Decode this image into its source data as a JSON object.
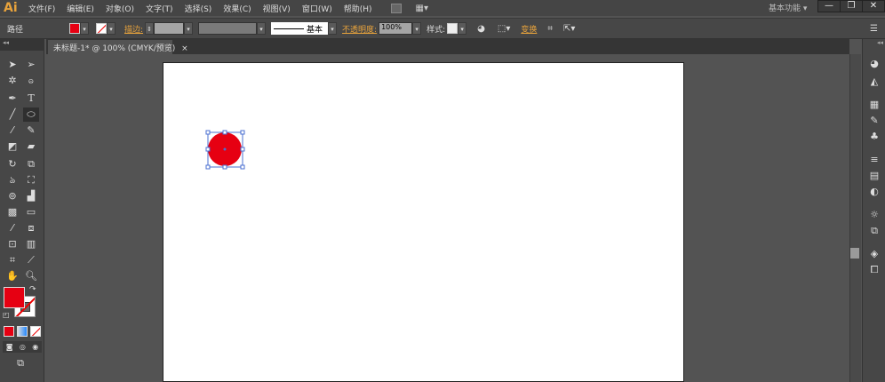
{
  "app": {
    "logo": "Ai",
    "workspace": "基本功能 ▾",
    "win": {
      "min": "—",
      "restore": "❐",
      "close": "✕"
    }
  },
  "menu": [
    "文件(F)",
    "编辑(E)",
    "对象(O)",
    "文字(T)",
    "选择(S)",
    "效果(C)",
    "视图(V)",
    "窗口(W)",
    "帮助(H)"
  ],
  "control": {
    "object_type": "路径",
    "stroke_label": "描边:",
    "stroke_style": "基本",
    "opacity_label": "不透明度:",
    "opacity": "100%",
    "style_label": "样式:",
    "transform": "变换"
  },
  "document": {
    "tab": "未标题-1* @ 100% (CMYK/预览)",
    "close": "×"
  },
  "colors": {
    "fill": "#e60012",
    "accent": "#e8a33c",
    "selection": "#4a6fd1"
  },
  "icons": {
    "dd": "▾",
    "collapse": "◂◂"
  }
}
